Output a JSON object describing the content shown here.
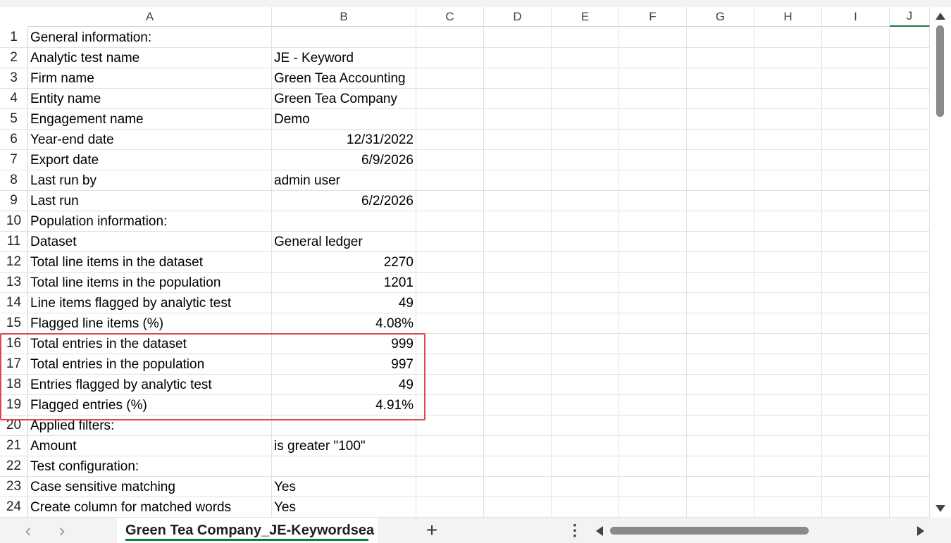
{
  "columns": [
    "A",
    "B",
    "C",
    "D",
    "E",
    "F",
    "G",
    "H",
    "I",
    "J"
  ],
  "rows": [
    {
      "num": "1",
      "a": "General information:",
      "b": ""
    },
    {
      "num": "2",
      "a": "Analytic test name",
      "b": "JE - Keyword"
    },
    {
      "num": "3",
      "a": "Firm name",
      "b": "Green Tea Accounting"
    },
    {
      "num": "4",
      "a": "Entity name",
      "b": "Green Tea Company"
    },
    {
      "num": "5",
      "a": "Engagement name",
      "b": "Demo"
    },
    {
      "num": "6",
      "a": "Year-end date",
      "b": "12/31/2022",
      "right": true
    },
    {
      "num": "7",
      "a": "Export date",
      "b": "6/9/2026",
      "right": true
    },
    {
      "num": "8",
      "a": "Last run by",
      "b": "admin user"
    },
    {
      "num": "9",
      "a": "Last run",
      "b": "6/2/2026",
      "right": true
    },
    {
      "num": "10",
      "a": "Population information:",
      "b": ""
    },
    {
      "num": "11",
      "a": "Dataset",
      "b": "General ledger"
    },
    {
      "num": "12",
      "a": "Total line items in the dataset",
      "b": "2270",
      "right": true
    },
    {
      "num": "13",
      "a": "Total line items in the population",
      "b": "1201",
      "right": true
    },
    {
      "num": "14",
      "a": "Line items flagged by analytic test",
      "b": "49",
      "right": true
    },
    {
      "num": "15",
      "a": "Flagged line items (%)",
      "b": "4.08%",
      "right": true
    },
    {
      "num": "16",
      "a": "Total entries in the dataset",
      "b": "999",
      "right": true
    },
    {
      "num": "17",
      "a": "Total entries in the population",
      "b": "997",
      "right": true
    },
    {
      "num": "18",
      "a": "Entries flagged by analytic test",
      "b": "49",
      "right": true
    },
    {
      "num": "19",
      "a": "Flagged entries (%)",
      "b": "4.91%",
      "right": true
    },
    {
      "num": "20",
      "a": "Applied filters:",
      "b": ""
    },
    {
      "num": "21",
      "a": "Amount",
      "b": "is greater \"100\""
    },
    {
      "num": "22",
      "a": "Test configuration:",
      "b": ""
    },
    {
      "num": "23",
      "a": "Case sensitive matching",
      "b": "Yes"
    },
    {
      "num": "24",
      "a": "Create column for matched words",
      "b": "Yes"
    }
  ],
  "sheet_tab": {
    "label": "Green Tea Company_JE-Keywordsea"
  },
  "add_sheet_label": "+",
  "more_label": "⋮",
  "nav_prev": "‹",
  "nav_next": "›",
  "colors": {
    "highlight": "#e0474c",
    "active_tab_underline": "#107c41"
  }
}
